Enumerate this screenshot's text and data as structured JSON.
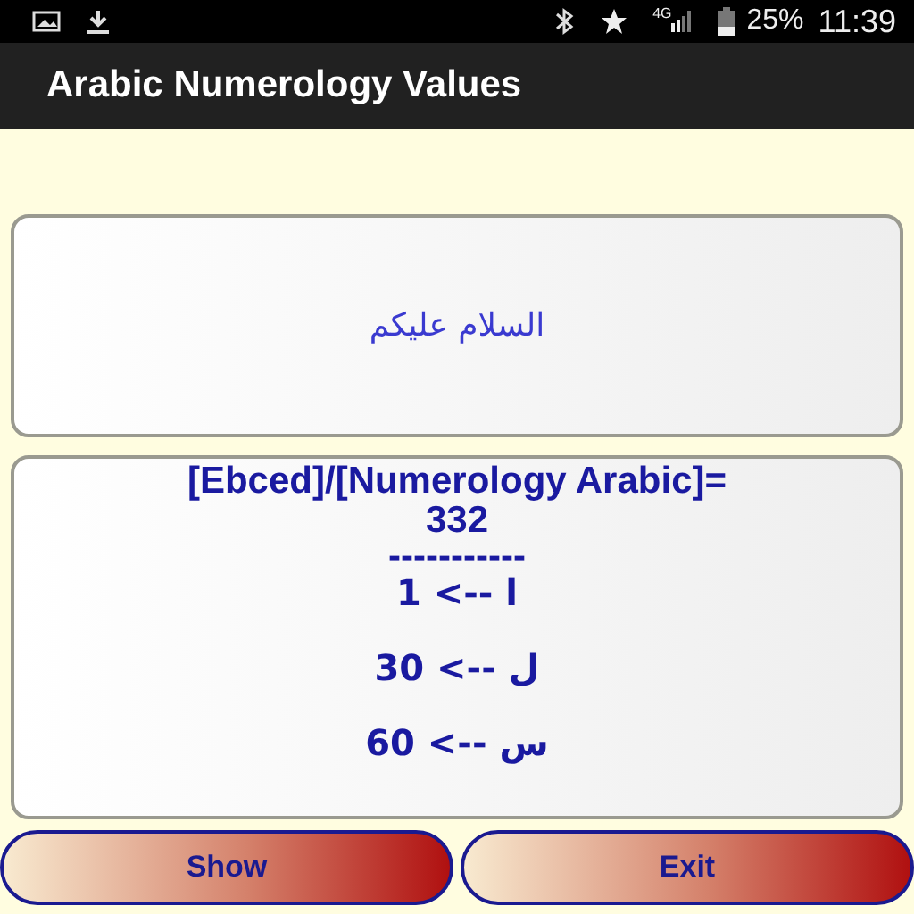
{
  "status_bar": {
    "network": "4G",
    "battery": "25%",
    "time": "11:39"
  },
  "app_bar": {
    "title": "Arabic Numerology Values"
  },
  "input": {
    "value": "السلام عليكم"
  },
  "result": {
    "heading": "[Ebced]/[Numerology Arabic]=",
    "total": "332",
    "separator": "-----------",
    "lines": [
      "1 <-- ا",
      "30 <-- ل",
      "60 <-- س"
    ]
  },
  "show_button": {
    "label": "Show"
  },
  "exit_button": {
    "label": "Exit"
  }
}
